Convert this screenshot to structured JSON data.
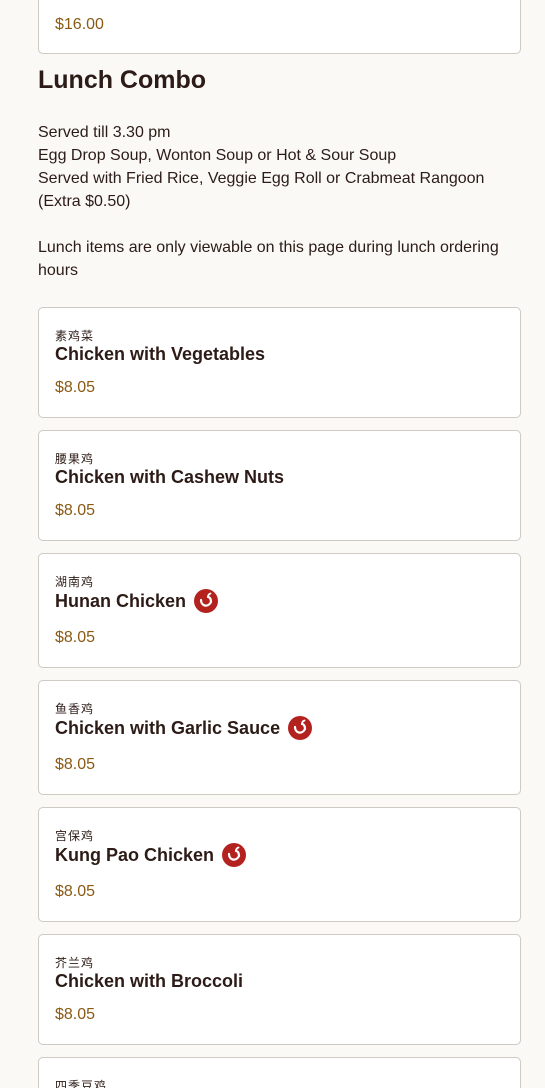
{
  "prev_item": {
    "price": "$16.00"
  },
  "section": {
    "title": "Lunch Combo",
    "description_lines": [
      "Served till 3.30 pm",
      "Egg Drop Soup, Wonton Soup or Hot & Sour Soup",
      "Served with Fried Rice, Veggie Egg Roll or Crabmeat Rangoon (Extra $0.50)"
    ],
    "note": "Lunch items are only viewable on this page during lunch ordering hours"
  },
  "items": [
    {
      "chinese": "素鸡菜",
      "name": "Chicken with Vegetables",
      "price": "$8.05",
      "spicy": false
    },
    {
      "chinese": "腰果鸡",
      "name": "Chicken with Cashew Nuts",
      "price": "$8.05",
      "spicy": false
    },
    {
      "chinese": "湖南鸡",
      "name": "Hunan Chicken",
      "price": "$8.05",
      "spicy": true
    },
    {
      "chinese": "鱼香鸡",
      "name": "Chicken with Garlic Sauce",
      "price": "$8.05",
      "spicy": true
    },
    {
      "chinese": "宫保鸡",
      "name": "Kung Pao Chicken",
      "price": "$8.05",
      "spicy": true
    },
    {
      "chinese": "芥兰鸡",
      "name": "Chicken with Broccoli",
      "price": "$8.05",
      "spicy": false
    },
    {
      "chinese": "四季豆鸡"
    }
  ],
  "icons": {
    "spicy": "chili-pepper-icon"
  },
  "colors": {
    "price": "#8a5a14",
    "spicy_badge": "#b3221e",
    "card_border": "#cfcac2"
  }
}
